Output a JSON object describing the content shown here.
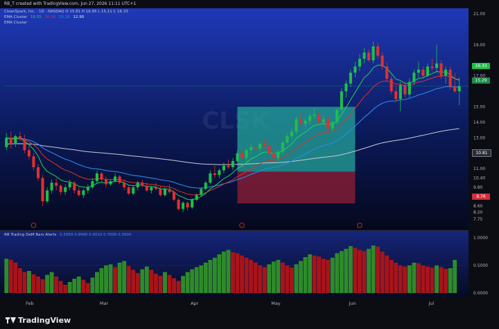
{
  "header": {
    "caption": "RB_T created with TradingView.com, Jun 27, 2026 11:11 UTC+1"
  },
  "legend": {
    "symbol_line": "CleanSpark, Inc. · 1D · NASDAQ  O 15.81  H 16.95  L 15.11  C 16.33",
    "ema_cluster_1": {
      "label": "EMA Cluster",
      "v1": "16.55",
      "v2": "16.18",
      "v3": "15.29",
      "v4": "12.90"
    },
    "ema_cluster_2": {
      "label": "EMA Cluster"
    },
    "indicator_title": "RB Trading DeM Bars Alerts",
    "indicator_values": "0.5959  0.9990  0.0010  0.7000  0.3000"
  },
  "watermark": "CLSK",
  "price_axis": {
    "ticks": [
      "21.00",
      "19.00",
      "17.00",
      "15.00",
      "14.00",
      "13.00",
      "12.00",
      "11.00",
      "10.40",
      "9.80",
      "9.20",
      "8.60",
      "8.20",
      "7.75"
    ],
    "labels": {
      "last": "16.33",
      "ema": "15.29",
      "entry": "10.81",
      "stop": "8.76"
    }
  },
  "indicator_axis": {
    "ticks": [
      "1.0000",
      "0.5000",
      "0.0000"
    ]
  },
  "time_axis": {
    "ticks": [
      "Feb",
      "Mar",
      "Apr",
      "May",
      "Jun",
      "Jul"
    ]
  },
  "colors": {
    "up": "#1fbf4a",
    "down": "#e0312d",
    "ema_fast": "#1fd65b",
    "ema_mid": "#e0312d",
    "ema_slow": "#2b8ae8",
    "ema_long": "#c9ccd6",
    "target": "#24a59a",
    "stop": "#9b2035"
  },
  "brand": {
    "name": "TradingView"
  },
  "chart_data": {
    "type": "candlestick",
    "price_range": [
      7.75,
      21.0
    ],
    "candles_ohlc": [
      [
        12.4,
        13.3,
        12.2,
        13.0
      ],
      [
        13.0,
        13.4,
        12.3,
        12.6
      ],
      [
        12.6,
        13.2,
        12.4,
        13.1
      ],
      [
        13.1,
        13.4,
        12.8,
        12.9
      ],
      [
        12.9,
        13.2,
        12.0,
        12.2
      ],
      [
        12.2,
        12.5,
        11.6,
        11.8
      ],
      [
        11.8,
        12.0,
        10.9,
        11.1
      ],
      [
        11.1,
        11.3,
        10.2,
        10.4
      ],
      [
        10.4,
        10.6,
        8.6,
        8.9
      ],
      [
        8.9,
        9.8,
        8.8,
        9.6
      ],
      [
        9.6,
        10.3,
        9.4,
        10.1
      ],
      [
        10.1,
        10.4,
        9.6,
        9.9
      ],
      [
        9.9,
        10.0,
        9.3,
        9.5
      ],
      [
        9.5,
        10.0,
        9.3,
        9.8
      ],
      [
        9.8,
        10.3,
        9.6,
        10.1
      ],
      [
        10.1,
        10.2,
        9.4,
        9.6
      ],
      [
        9.6,
        9.8,
        9.2,
        9.3
      ],
      [
        9.3,
        9.7,
        9.1,
        9.6
      ],
      [
        9.6,
        10.0,
        9.4,
        9.8
      ],
      [
        9.8,
        10.4,
        9.7,
        10.2
      ],
      [
        10.2,
        10.9,
        10.0,
        10.7
      ],
      [
        10.7,
        10.8,
        10.1,
        10.3
      ],
      [
        10.3,
        10.5,
        9.8,
        10.0
      ],
      [
        10.0,
        10.3,
        9.9,
        10.2
      ],
      [
        10.2,
        10.7,
        10.1,
        10.5
      ],
      [
        10.5,
        10.6,
        10.0,
        10.1
      ],
      [
        10.1,
        10.3,
        9.6,
        9.8
      ],
      [
        9.8,
        9.9,
        9.3,
        9.4
      ],
      [
        9.4,
        9.9,
        9.3,
        9.8
      ],
      [
        9.8,
        10.2,
        9.6,
        10.1
      ],
      [
        10.1,
        10.3,
        9.8,
        9.9
      ],
      [
        9.9,
        10.1,
        9.5,
        9.6
      ],
      [
        9.6,
        9.9,
        9.4,
        9.8
      ],
      [
        9.8,
        10.1,
        9.6,
        9.7
      ],
      [
        9.7,
        9.9,
        9.2,
        9.3
      ],
      [
        9.3,
        9.8,
        9.2,
        9.7
      ],
      [
        9.7,
        10.0,
        9.4,
        9.5
      ],
      [
        9.5,
        9.6,
        8.9,
        9.0
      ],
      [
        9.0,
        9.1,
        8.3,
        8.4
      ],
      [
        8.4,
        8.9,
        8.2,
        8.8
      ],
      [
        8.8,
        8.9,
        8.3,
        8.5
      ],
      [
        8.5,
        9.1,
        8.4,
        9.0
      ],
      [
        9.0,
        9.4,
        8.9,
        9.3
      ],
      [
        9.3,
        9.8,
        9.2,
        9.7
      ],
      [
        9.7,
        10.2,
        9.6,
        10.1
      ],
      [
        10.1,
        10.9,
        10.0,
        10.7
      ],
      [
        10.7,
        11.2,
        10.4,
        10.6
      ],
      [
        10.6,
        11.0,
        10.4,
        10.9
      ],
      [
        10.9,
        11.4,
        10.7,
        11.2
      ],
      [
        11.2,
        11.6,
        11.0,
        11.1
      ],
      [
        11.1,
        11.7,
        10.9,
        11.5
      ],
      [
        11.5,
        12.2,
        11.4,
        12.0
      ],
      [
        12.0,
        12.3,
        11.6,
        11.7
      ],
      [
        11.7,
        12.3,
        11.5,
        12.2
      ],
      [
        12.2,
        12.6,
        12.0,
        12.4
      ],
      [
        12.4,
        12.8,
        12.2,
        12.3
      ],
      [
        12.3,
        12.7,
        12.1,
        12.6
      ],
      [
        12.6,
        12.9,
        12.3,
        12.5
      ],
      [
        12.5,
        12.7,
        11.9,
        12.0
      ],
      [
        12.0,
        12.3,
        11.5,
        11.7
      ],
      [
        11.7,
        12.2,
        11.5,
        12.1
      ],
      [
        12.1,
        12.8,
        11.9,
        12.7
      ],
      [
        12.7,
        13.3,
        12.6,
        13.1
      ],
      [
        13.1,
        13.6,
        12.9,
        13.4
      ],
      [
        13.4,
        14.4,
        13.2,
        14.2
      ],
      [
        14.2,
        14.6,
        13.8,
        13.9
      ],
      [
        13.9,
        14.3,
        13.6,
        14.1
      ],
      [
        14.1,
        14.6,
        13.9,
        14.4
      ],
      [
        14.4,
        14.9,
        14.2,
        14.5
      ],
      [
        14.5,
        14.7,
        13.9,
        14.0
      ],
      [
        14.0,
        14.4,
        13.8,
        14.2
      ],
      [
        14.2,
        14.4,
        13.4,
        13.6
      ],
      [
        13.6,
        14.1,
        13.4,
        14.0
      ],
      [
        14.0,
        14.9,
        13.9,
        14.8
      ],
      [
        14.8,
        16.2,
        14.7,
        16.0
      ],
      [
        16.0,
        16.7,
        15.6,
        16.5
      ],
      [
        16.5,
        17.4,
        16.3,
        17.2
      ],
      [
        17.2,
        17.9,
        16.9,
        17.6
      ],
      [
        17.6,
        18.4,
        17.3,
        18.1
      ],
      [
        18.1,
        18.8,
        17.8,
        18.5
      ],
      [
        18.5,
        18.7,
        17.9,
        18.0
      ],
      [
        18.0,
        19.2,
        17.8,
        18.9
      ],
      [
        18.9,
        19.1,
        18.1,
        18.3
      ],
      [
        18.3,
        18.5,
        17.4,
        17.6
      ],
      [
        17.6,
        17.9,
        16.6,
        16.8
      ],
      [
        16.8,
        17.0,
        15.8,
        16.0
      ],
      [
        16.0,
        16.3,
        15.3,
        15.5
      ],
      [
        15.5,
        16.6,
        14.7,
        16.4
      ],
      [
        16.4,
        16.6,
        15.6,
        15.8
      ],
      [
        15.8,
        16.8,
        15.6,
        16.6
      ],
      [
        16.6,
        17.4,
        16.4,
        17.2
      ],
      [
        17.2,
        17.9,
        16.9,
        17.4
      ],
      [
        17.4,
        17.6,
        16.8,
        17.0
      ],
      [
        17.0,
        17.8,
        16.9,
        17.6
      ],
      [
        17.6,
        18.1,
        17.3,
        17.5
      ],
      [
        17.5,
        19.0,
        17.2,
        17.8
      ],
      [
        17.8,
        18.0,
        16.8,
        17.0
      ],
      [
        17.0,
        17.6,
        16.5,
        17.4
      ],
      [
        17.4,
        17.6,
        16.1,
        16.3
      ],
      [
        16.3,
        17.2,
        15.9,
        16.0
      ],
      [
        16.0,
        16.9,
        15.1,
        16.33
      ]
    ],
    "dem_bars": [
      0.62,
      0.6,
      0.55,
      0.45,
      0.38,
      0.4,
      0.34,
      0.3,
      0.25,
      0.33,
      0.38,
      0.3,
      0.22,
      0.15,
      0.2,
      0.26,
      0.3,
      0.24,
      0.18,
      0.28,
      0.38,
      0.45,
      0.5,
      0.52,
      0.47,
      0.55,
      0.58,
      0.49,
      0.42,
      0.36,
      0.43,
      0.48,
      0.42,
      0.35,
      0.31,
      0.38,
      0.33,
      0.27,
      0.22,
      0.31,
      0.38,
      0.43,
      0.47,
      0.5,
      0.55,
      0.6,
      0.64,
      0.7,
      0.75,
      0.78,
      0.74,
      0.72,
      0.68,
      0.64,
      0.6,
      0.55,
      0.5,
      0.47,
      0.52,
      0.57,
      0.6,
      0.55,
      0.5,
      0.46,
      0.52,
      0.58,
      0.65,
      0.7,
      0.68,
      0.66,
      0.62,
      0.6,
      0.64,
      0.72,
      0.76,
      0.8,
      0.85,
      0.82,
      0.78,
      0.76,
      0.8,
      0.86,
      0.84,
      0.75,
      0.68,
      0.6,
      0.55,
      0.5,
      0.48,
      0.5,
      0.55,
      0.54,
      0.5,
      0.48,
      0.46,
      0.5,
      0.47,
      0.44,
      0.45,
      0.6
    ],
    "dem_range": [
      0,
      1
    ],
    "position": {
      "entry": 10.81,
      "target": 15.0,
      "stop": 8.76
    }
  }
}
